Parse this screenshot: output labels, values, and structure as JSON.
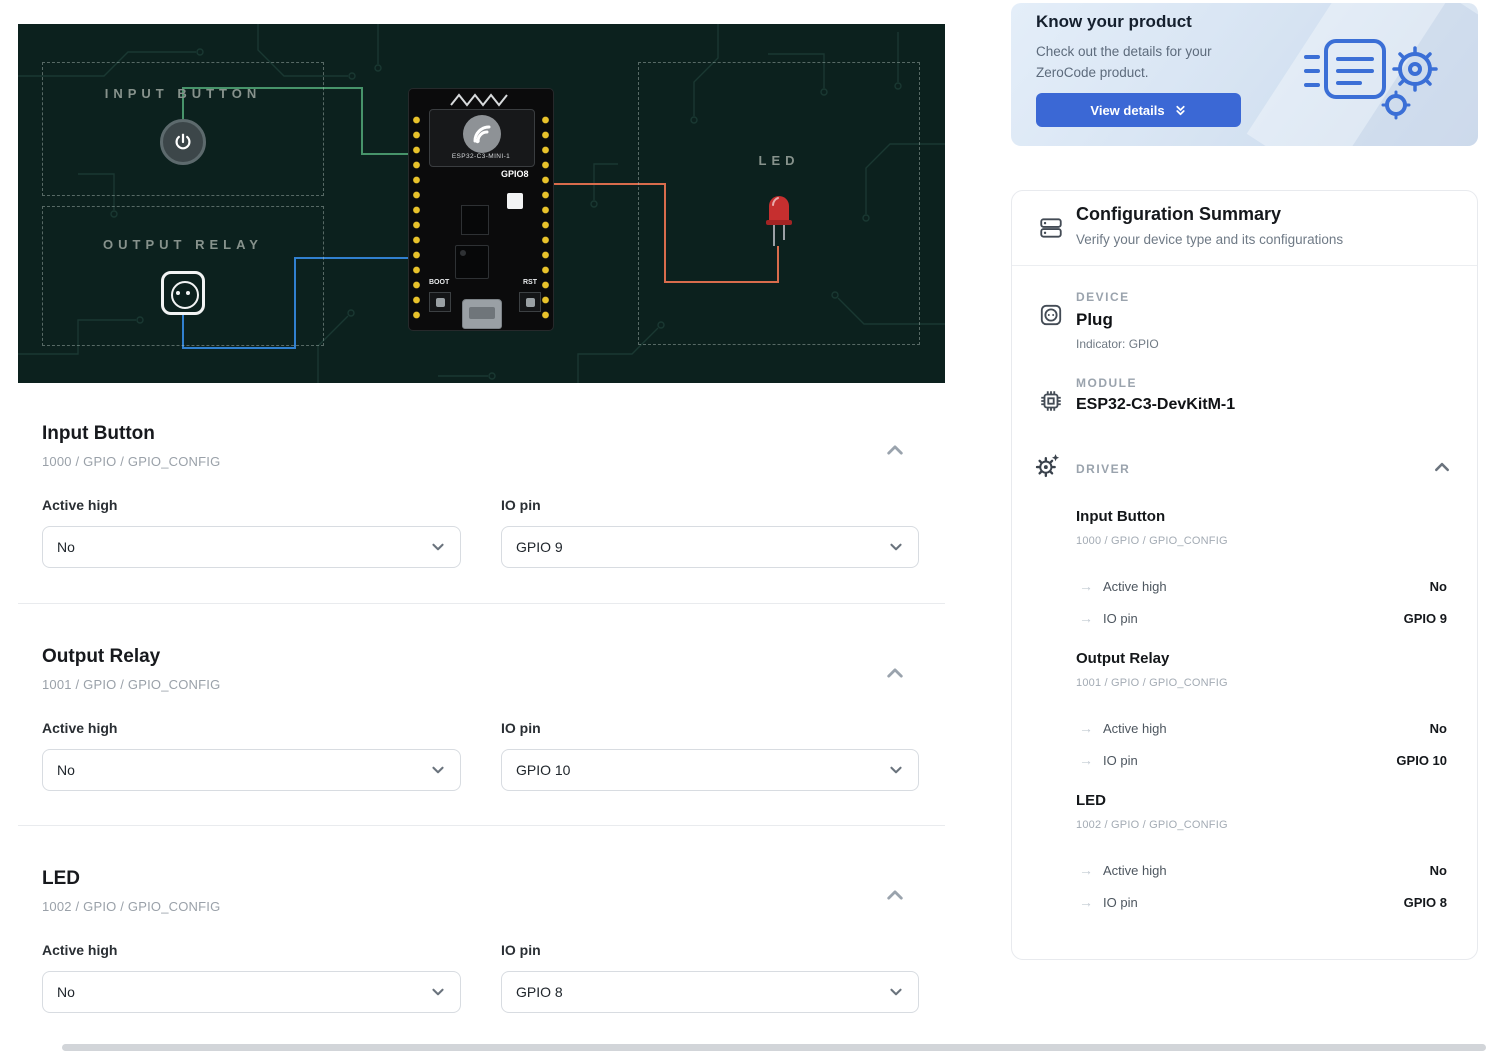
{
  "board": {
    "input_button_label": "INPUT BUTTON",
    "output_relay_label": "OUTPUT RELAY",
    "led_label": "LED",
    "module_name": "ESP32-C3-MINI-1",
    "gpio8_label": "GPIO8",
    "boot_label": "BOOT",
    "rst_label": "RST"
  },
  "sections": [
    {
      "title": "Input Button",
      "code": "1000 / GPIO / GPIO_CONFIG",
      "fields": [
        {
          "label": "Active high",
          "value": "No"
        },
        {
          "label": "IO pin",
          "value": "GPIO 9"
        }
      ]
    },
    {
      "title": "Output Relay",
      "code": "1001 / GPIO / GPIO_CONFIG",
      "fields": [
        {
          "label": "Active high",
          "value": "No"
        },
        {
          "label": "IO pin",
          "value": "GPIO 10"
        }
      ]
    },
    {
      "title": "LED",
      "code": "1002 / GPIO / GPIO_CONFIG",
      "fields": [
        {
          "label": "Active high",
          "value": "No"
        },
        {
          "label": "IO pin",
          "value": "GPIO 8"
        }
      ]
    }
  ],
  "promo": {
    "title": "Know your product",
    "body": "Check out the details for your ZeroCode product.",
    "button_label": "View details"
  },
  "summary": {
    "title": "Configuration Summary",
    "subtitle": "Verify your device type and its configurations",
    "device": {
      "kicker": "DEVICE",
      "name": "Plug",
      "sub": "Indicator: GPIO"
    },
    "module": {
      "kicker": "MODULE",
      "name": "ESP32-C3-DevKitM-1"
    },
    "driver": {
      "kicker": "DRIVER",
      "entries": [
        {
          "name": "Input Button",
          "code": "1000 / GPIO / GPIO_CONFIG",
          "rows": [
            {
              "label": "Active high",
              "value": "No"
            },
            {
              "label": "IO pin",
              "value": "GPIO 9"
            }
          ]
        },
        {
          "name": "Output Relay",
          "code": "1001 / GPIO / GPIO_CONFIG",
          "rows": [
            {
              "label": "Active high",
              "value": "No"
            },
            {
              "label": "IO pin",
              "value": "GPIO 10"
            }
          ]
        },
        {
          "name": "LED",
          "code": "1002 / GPIO / GPIO_CONFIG",
          "rows": [
            {
              "label": "Active high",
              "value": "No"
            },
            {
              "label": "IO pin",
              "value": "GPIO 8"
            }
          ]
        }
      ]
    }
  },
  "colors": {
    "accent_blue": "#3b68d5",
    "board_bg": "#0c211e",
    "wire_green": "#47946a",
    "wire_blue": "#3180cf",
    "wire_orange": "#d96c4c",
    "led_red": "#c62f2f",
    "pin_yellow": "#e9c32b"
  },
  "icons": {
    "view_details": "double-chevron-down",
    "collapse": "chevron-up",
    "dropdown": "chevron-down",
    "summary_header": "stack",
    "device": "socket",
    "module": "chip",
    "driver": "gear-sparkle",
    "driver_row": "arrow-right"
  }
}
